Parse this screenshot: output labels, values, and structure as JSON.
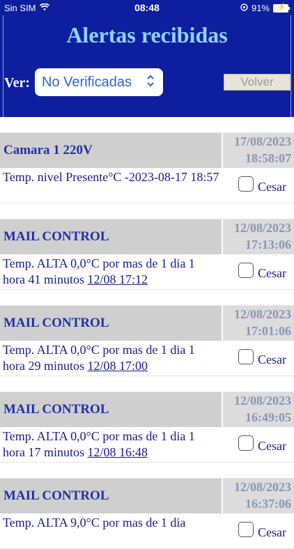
{
  "status_bar": {
    "carrier": "Sin SIM",
    "time": "08:48",
    "battery": "91%"
  },
  "header": {
    "title": "Alertas recibidas",
    "ver_label": "Ver:",
    "filter_value": "No Verificadas",
    "volver_label": "Volver"
  },
  "alerts": [
    {
      "title": "Camara 1 220V",
      "date": "17/08/2023",
      "time": "18:58:07",
      "message": "Temp. nivel Presente°C -2023-08-17 18:57",
      "link": "",
      "user": "Cesar"
    },
    {
      "title": "MAIL CONTROL",
      "date": "12/08/2023",
      "time": "17:13:06",
      "message": "Temp. ALTA 0,0°C por mas de 1 dia 1 hora 41 minutos ",
      "link": "12/08 17:12",
      "user": "Cesar"
    },
    {
      "title": "MAIL CONTROL",
      "date": "12/08/2023",
      "time": "17:01:06",
      "message": "Temp. ALTA 0,0°C por mas de 1 dia 1 hora 29 minutos ",
      "link": "12/08 17:00",
      "user": "Cesar"
    },
    {
      "title": "MAIL CONTROL",
      "date": "12/08/2023",
      "time": "16:49:05",
      "message": "Temp. ALTA 0,0°C por mas de 1 dia 1 hora 17 minutos ",
      "link": "12/08 16:48",
      "user": "Cesar"
    },
    {
      "title": "MAIL CONTROL",
      "date": "12/08/2023",
      "time": "16:37:06",
      "message": "Temp. ALTA 9,0°C por mas de 1 dia",
      "link": "",
      "user": "Cesar"
    }
  ]
}
